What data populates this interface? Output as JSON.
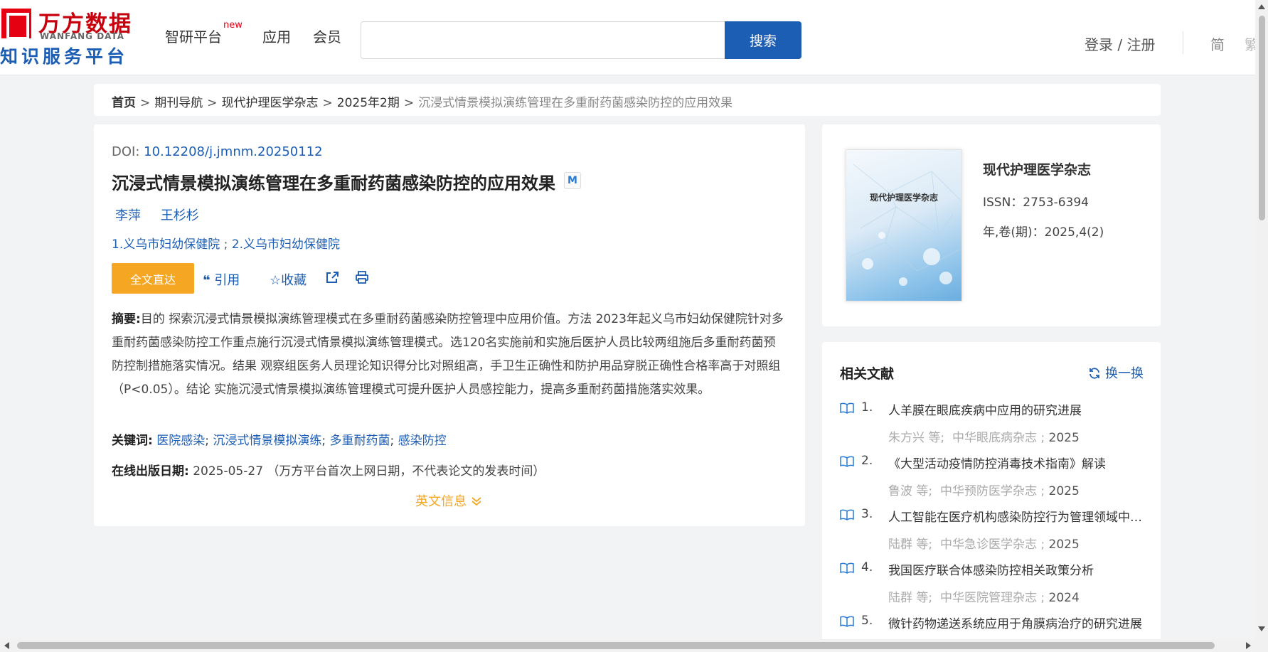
{
  "header": {
    "logo_cn": "万方数据",
    "logo_en": "WANFANG DATA",
    "logo_sub": "知识服务平台",
    "nav": [
      {
        "label": "智研平台",
        "badge": "new"
      },
      {
        "label": "应用"
      },
      {
        "label": "会员"
      }
    ],
    "search": {
      "placeholder": "",
      "button": "搜索"
    },
    "login": "登录 / 注册",
    "lang": "简",
    "lang2": "繁"
  },
  "breadcrumb": {
    "home": "首页",
    "items": [
      "期刊导航",
      "现代护理医学杂志",
      "2025年2期"
    ],
    "current": "沉浸式情景模拟演练管理在多重耐药菌感染防控的应用效果",
    "sep": ">"
  },
  "article": {
    "doi_label": "DOI: ",
    "doi": "10.12208/j.jmnm.20250112",
    "title": "沉浸式情景模拟演练管理在多重耐药菌感染防控的应用效果",
    "badge": "M",
    "authors": [
      "李萍",
      "王杉杉"
    ],
    "affiliations": [
      "1.义乌市妇幼保健院",
      "2.义乌市妇幼保健院"
    ],
    "affil_sep": ";",
    "actions": {
      "fulltext": "全文直达",
      "cite": "引用",
      "favorite": "收藏"
    },
    "abstract_label": "摘要:",
    "abstract": "目的 探索沉浸式情景模拟演练管理模式在多重耐药菌感染防控管理中应用价值。方法 2023年起义乌市妇幼保健院针对多重耐药菌感染防控工作重点施行沉浸式情景模拟演练管理模式。选120名实施前和实施后医护人员比较两组施后多重耐药菌预防控制措施落实情况。结果 观察组医务人员理论知识得分比对照组高，手卫生正确性和防护用品穿脱正确性合格率高于对照组（P<0.05）。结论 实施沉浸式情景模拟演练管理模式可提升医护人员感控能力，提高多重耐药菌措施落实效果。",
    "keywords_label": "关键词:",
    "keywords": [
      "医院感染",
      "沉浸式情景模拟演练",
      "多重耐药菌",
      "感染防控"
    ],
    "pubdate_label": "在线出版日期:",
    "pubdate": "2025-05-27",
    "pubdate_note": "（万方平台首次上网日期，不代表论文的发表时间）",
    "en_info": "英文信息"
  },
  "journal": {
    "cover_title": "现代护理医学杂志",
    "name": "现代护理医学杂志",
    "issn": "ISSN：2753-6394",
    "volume": "年,卷(期)：2025,4(2)"
  },
  "related": {
    "title": "相关文献",
    "refresh": "换一换",
    "items": [
      {
        "num": "1.",
        "title": "人羊膜在眼底疾病中应用的研究进展",
        "author": "朱方兴  等;",
        "source": "中华眼底病杂志 ;",
        "year": "2025"
      },
      {
        "num": "2.",
        "title": "《大型活动疫情防控消毒技术指南》解读",
        "author": "鲁波  等;",
        "source": "中华预防医学杂志 ;",
        "year": "2025"
      },
      {
        "num": "3.",
        "title": "人工智能在医疗机构感染防控行为管理领域中的应用",
        "author": "陆群  等;",
        "source": "中华急诊医学杂志 ;",
        "year": "2025"
      },
      {
        "num": "4.",
        "title": "我国医疗联合体感染防控相关政策分析",
        "author": "陆群  等;",
        "source": "中华医院管理杂志 ;",
        "year": "2024"
      },
      {
        "num": "5.",
        "title": "微针药物递送系统应用于角膜病治疗的研究进展",
        "author": "",
        "source": "",
        "year": ""
      }
    ]
  },
  "colors": {
    "brand_blue": "#1d5eb5",
    "brand_red": "#e50012",
    "accent_orange": "#f5a623"
  }
}
